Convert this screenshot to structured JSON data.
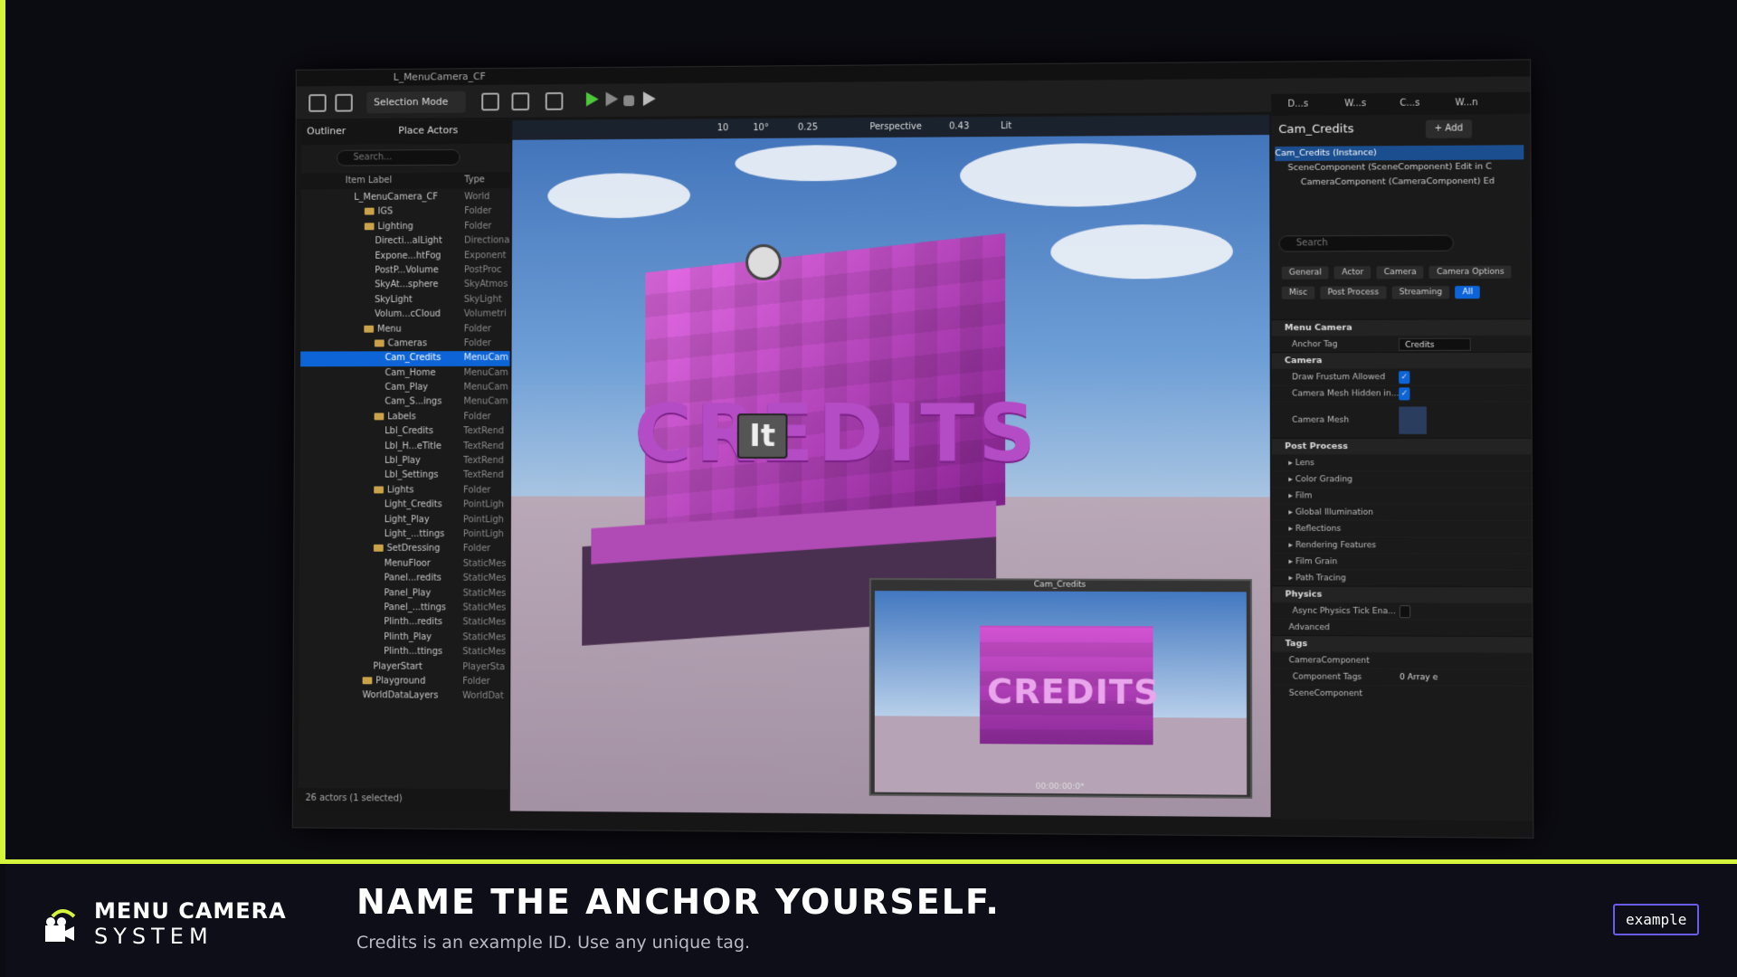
{
  "editor": {
    "project_tab": "L_MenuCamera_CF",
    "toolbar": {
      "selection_mode": "Selection Mode"
    },
    "outliner": {
      "tab_outliner": "Outliner",
      "tab_place_actors": "Place Actors",
      "search_placeholder": "Search...",
      "col_label": "Item Label",
      "col_type": "Type",
      "footer": "26 actors (1 selected)",
      "rows": [
        {
          "label": "L_MenuCamera_CF",
          "type": "World",
          "indent": 0,
          "folder": false
        },
        {
          "label": "IGS",
          "type": "Folder",
          "indent": 1,
          "folder": true
        },
        {
          "label": "Lighting",
          "type": "Folder",
          "indent": 1,
          "folder": true
        },
        {
          "label": "Directi...alLight",
          "type": "Directiona",
          "indent": 2,
          "folder": false
        },
        {
          "label": "Expone...htFog",
          "type": "Exponent",
          "indent": 2,
          "folder": false
        },
        {
          "label": "PostP...Volume",
          "type": "PostProc",
          "indent": 2,
          "folder": false
        },
        {
          "label": "SkyAt...sphere",
          "type": "SkyAtmos",
          "indent": 2,
          "folder": false
        },
        {
          "label": "SkyLight",
          "type": "SkyLight",
          "indent": 2,
          "folder": false
        },
        {
          "label": "Volum...cCloud",
          "type": "Volumetri",
          "indent": 2,
          "folder": false
        },
        {
          "label": "Menu",
          "type": "Folder",
          "indent": 1,
          "folder": true
        },
        {
          "label": "Cameras",
          "type": "Folder",
          "indent": 2,
          "folder": true
        },
        {
          "label": "Cam_Credits",
          "type": "MenuCam",
          "indent": 3,
          "folder": false,
          "selected": true
        },
        {
          "label": "Cam_Home",
          "type": "MenuCam",
          "indent": 3,
          "folder": false
        },
        {
          "label": "Cam_Play",
          "type": "MenuCam",
          "indent": 3,
          "folder": false
        },
        {
          "label": "Cam_S...ings",
          "type": "MenuCam",
          "indent": 3,
          "folder": false
        },
        {
          "label": "Labels",
          "type": "Folder",
          "indent": 2,
          "folder": true
        },
        {
          "label": "Lbl_Credits",
          "type": "TextRend",
          "indent": 3,
          "folder": false
        },
        {
          "label": "Lbl_H...eTitle",
          "type": "TextRend",
          "indent": 3,
          "folder": false
        },
        {
          "label": "Lbl_Play",
          "type": "TextRend",
          "indent": 3,
          "folder": false
        },
        {
          "label": "Lbl_Settings",
          "type": "TextRend",
          "indent": 3,
          "folder": false
        },
        {
          "label": "Lights",
          "type": "Folder",
          "indent": 2,
          "folder": true
        },
        {
          "label": "Light_Credits",
          "type": "PointLigh",
          "indent": 3,
          "folder": false
        },
        {
          "label": "Light_Play",
          "type": "PointLigh",
          "indent": 3,
          "folder": false
        },
        {
          "label": "Light_...ttings",
          "type": "PointLigh",
          "indent": 3,
          "folder": false
        },
        {
          "label": "SetDressing",
          "type": "Folder",
          "indent": 2,
          "folder": true
        },
        {
          "label": "MenuFloor",
          "type": "StaticMes",
          "indent": 3,
          "folder": false
        },
        {
          "label": "Panel...redits",
          "type": "StaticMes",
          "indent": 3,
          "folder": false
        },
        {
          "label": "Panel_Play",
          "type": "StaticMes",
          "indent": 3,
          "folder": false
        },
        {
          "label": "Panel_...ttings",
          "type": "StaticMes",
          "indent": 3,
          "folder": false
        },
        {
          "label": "Plinth...redits",
          "type": "StaticMes",
          "indent": 3,
          "folder": false
        },
        {
          "label": "Plinth_Play",
          "type": "StaticMes",
          "indent": 3,
          "folder": false
        },
        {
          "label": "Plinth...ttings",
          "type": "StaticMes",
          "indent": 3,
          "folder": false
        },
        {
          "label": "PlayerStart",
          "type": "PlayerSta",
          "indent": 2,
          "folder": false
        },
        {
          "label": "Playground",
          "type": "Folder",
          "indent": 1,
          "folder": true
        },
        {
          "label": "WorldDataLayers",
          "type": "WorldDat",
          "indent": 1,
          "folder": false
        }
      ]
    },
    "viewport": {
      "perspective": "Perspective",
      "lit": "Lit",
      "speed": "0.43",
      "grid": "10",
      "angle": "10°",
      "scale": "0.25",
      "scene_text": "CREDITS",
      "pip_title": "Cam_Credits",
      "pip_text": "CREDITS",
      "pip_time": "00:00:00:0*"
    },
    "details": {
      "tabs": [
        "D...s",
        "W...s",
        "C...s",
        "W...n"
      ],
      "actor_name": "Cam_Credits",
      "add_label": "+ Add",
      "tree": [
        "Cam_Credits (Instance)",
        "SceneComponent (SceneComponent)  Edit in C",
        "CameraComponent (CameraComponent)  Ed"
      ],
      "search_placeholder": "Search",
      "chips": [
        "General",
        "Actor",
        "Camera",
        "Camera Options",
        "Misc",
        "Post Process",
        "Streaming",
        "All"
      ],
      "sec_menu_camera": "Menu Camera",
      "anchor_tag_label": "Anchor Tag",
      "anchor_tag_value": "Credits",
      "sec_camera": "Camera",
      "draw_frustum": "Draw Frustum Allowed",
      "mesh_hidden": "Camera Mesh Hidden in...",
      "camera_mesh": "Camera Mesh",
      "sec_post_process": "Post Process",
      "pp_items": [
        "Lens",
        "Color Grading",
        "Film",
        "Global Illumination",
        "Reflections",
        "Rendering Features",
        "Film Grain",
        "Path Tracing"
      ],
      "sec_physics": "Physics",
      "async_physics": "Async Physics Tick Ena...",
      "advanced": "Advanced",
      "sec_tags": "Tags",
      "camera_component": "CameraComponent",
      "component_tags": "Component Tags",
      "array_value": "0 Array e",
      "scene_component": "SceneComponent"
    }
  },
  "footer": {
    "brand_line1": "MENU CAMERA",
    "brand_line2": "SYSTEM",
    "headline": "NAME THE ANCHOR YOURSELF.",
    "subline": "Credits is an example ID. Use any unique tag.",
    "tag": "example"
  },
  "colors": {
    "accent": "#d4f53c",
    "selection": "#0d64d6",
    "tag_border": "#6b5cf0"
  }
}
